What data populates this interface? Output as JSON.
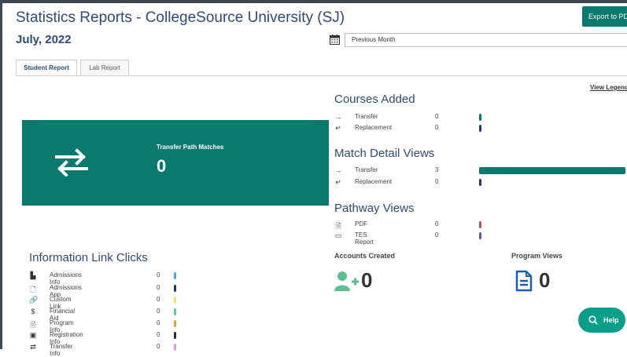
{
  "header": {
    "title": "Statistics Reports - CollegeSource University (SJ)",
    "period": "July, 2022",
    "export_label": "Export to PDF",
    "period_select": "Previous Month"
  },
  "tabs": [
    {
      "label": "Student Report",
      "active": true
    },
    {
      "label": "Lab Report",
      "active": false
    }
  ],
  "hero": {
    "label": "Transfer Path Matches",
    "value": "0",
    "icon": "swap-arrows-icon",
    "color": "#0b7a6e"
  },
  "view_legend": "View Legend",
  "courses_added": {
    "title": "Courses Added",
    "rows": [
      {
        "label": "Transfer",
        "value": "0",
        "icon": "arrow-right-icon",
        "color": "#0b7a6e",
        "fraction": 0
      },
      {
        "label": "Replacement",
        "value": "0",
        "icon": "return-arrow-icon",
        "color": "#1f3a7a",
        "fraction": 0
      }
    ]
  },
  "match_detail_views": {
    "title": "Match Detail Views",
    "rows": [
      {
        "label": "Transfer",
        "value": "3",
        "icon": "arrow-right-icon",
        "color": "#0b7a6e",
        "fraction": 1
      },
      {
        "label": "Replacement",
        "value": "0",
        "icon": "return-arrow-icon",
        "color": "#1f3a7a",
        "fraction": 0
      }
    ]
  },
  "pathway_views": {
    "title": "Pathway Views",
    "rows": [
      {
        "label": "PDF",
        "value": "0",
        "icon": "pdf-file-icon",
        "color": "#c0504d",
        "fraction": 0
      },
      {
        "label": "TES Report",
        "value": "0",
        "icon": "window-icon",
        "color": "#5b5ea6",
        "fraction": 0
      }
    ]
  },
  "accounts_created": {
    "label": "Accounts Created",
    "value": "0",
    "icon": "add-user-icon",
    "color": "#5bbf8f"
  },
  "program_views": {
    "label": "Program Views",
    "value": "0",
    "icon": "document-icon",
    "color": "#1f5fa8"
  },
  "information_link_clicks": {
    "title": "Information Link Clicks",
    "rows": [
      {
        "label": "Admissions Info",
        "value": "0",
        "icon": "building-icon",
        "color": "#3ab0d8"
      },
      {
        "label": "Admissions App",
        "value": "0",
        "icon": "file-icon",
        "color": "#0d3a66"
      },
      {
        "label": "Custom Link",
        "value": "0",
        "icon": "link-icon",
        "color": "#f2e26b"
      },
      {
        "label": "Financial Aid",
        "value": "0",
        "icon": "dollar-icon",
        "color": "#5bc4b0"
      },
      {
        "label": "Program Info",
        "value": "0",
        "icon": "file-text-icon",
        "color": "#f59b2e"
      },
      {
        "label": "Registration Info",
        "value": "0",
        "icon": "registration-icon",
        "color": "#2d2d2d"
      },
      {
        "label": "Transfer Info",
        "value": "0",
        "icon": "transfer-icon",
        "color": "#e19ad6"
      }
    ]
  },
  "help": {
    "label": "Help",
    "icon": "search-icon"
  }
}
